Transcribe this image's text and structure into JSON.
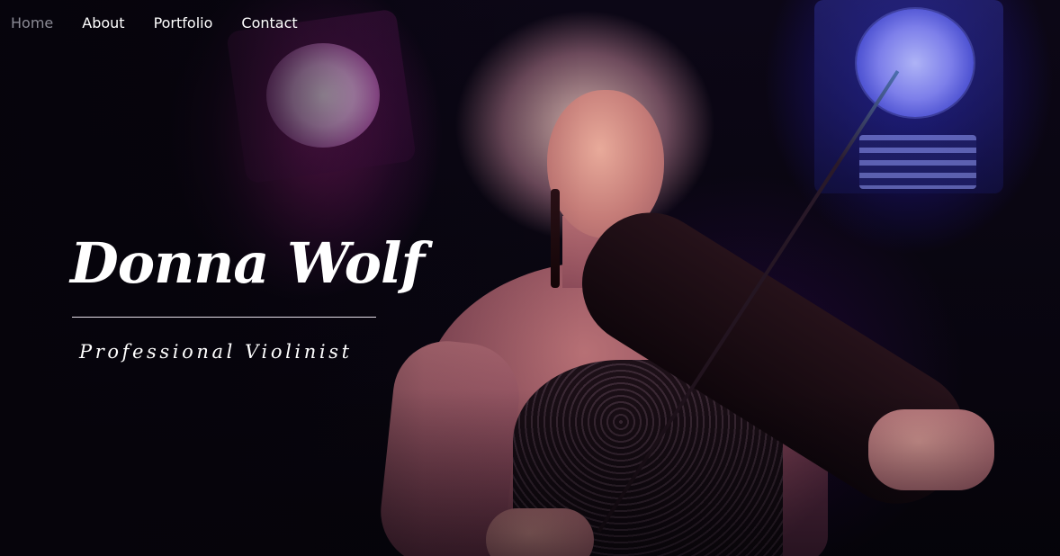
{
  "nav": {
    "items": [
      {
        "label": "Home",
        "active": true
      },
      {
        "label": "About",
        "active": false
      },
      {
        "label": "Portfolio",
        "active": false
      },
      {
        "label": "Contact",
        "active": false
      }
    ]
  },
  "hero": {
    "title": "Donna Wolf",
    "subtitle": "Professional Violinist"
  },
  "colors": {
    "nav_active": "#8a8a95",
    "nav_default": "#ffffff",
    "background": "#07050d",
    "accent_magenta": "#c428a0",
    "accent_blue": "#3c3cdc"
  }
}
